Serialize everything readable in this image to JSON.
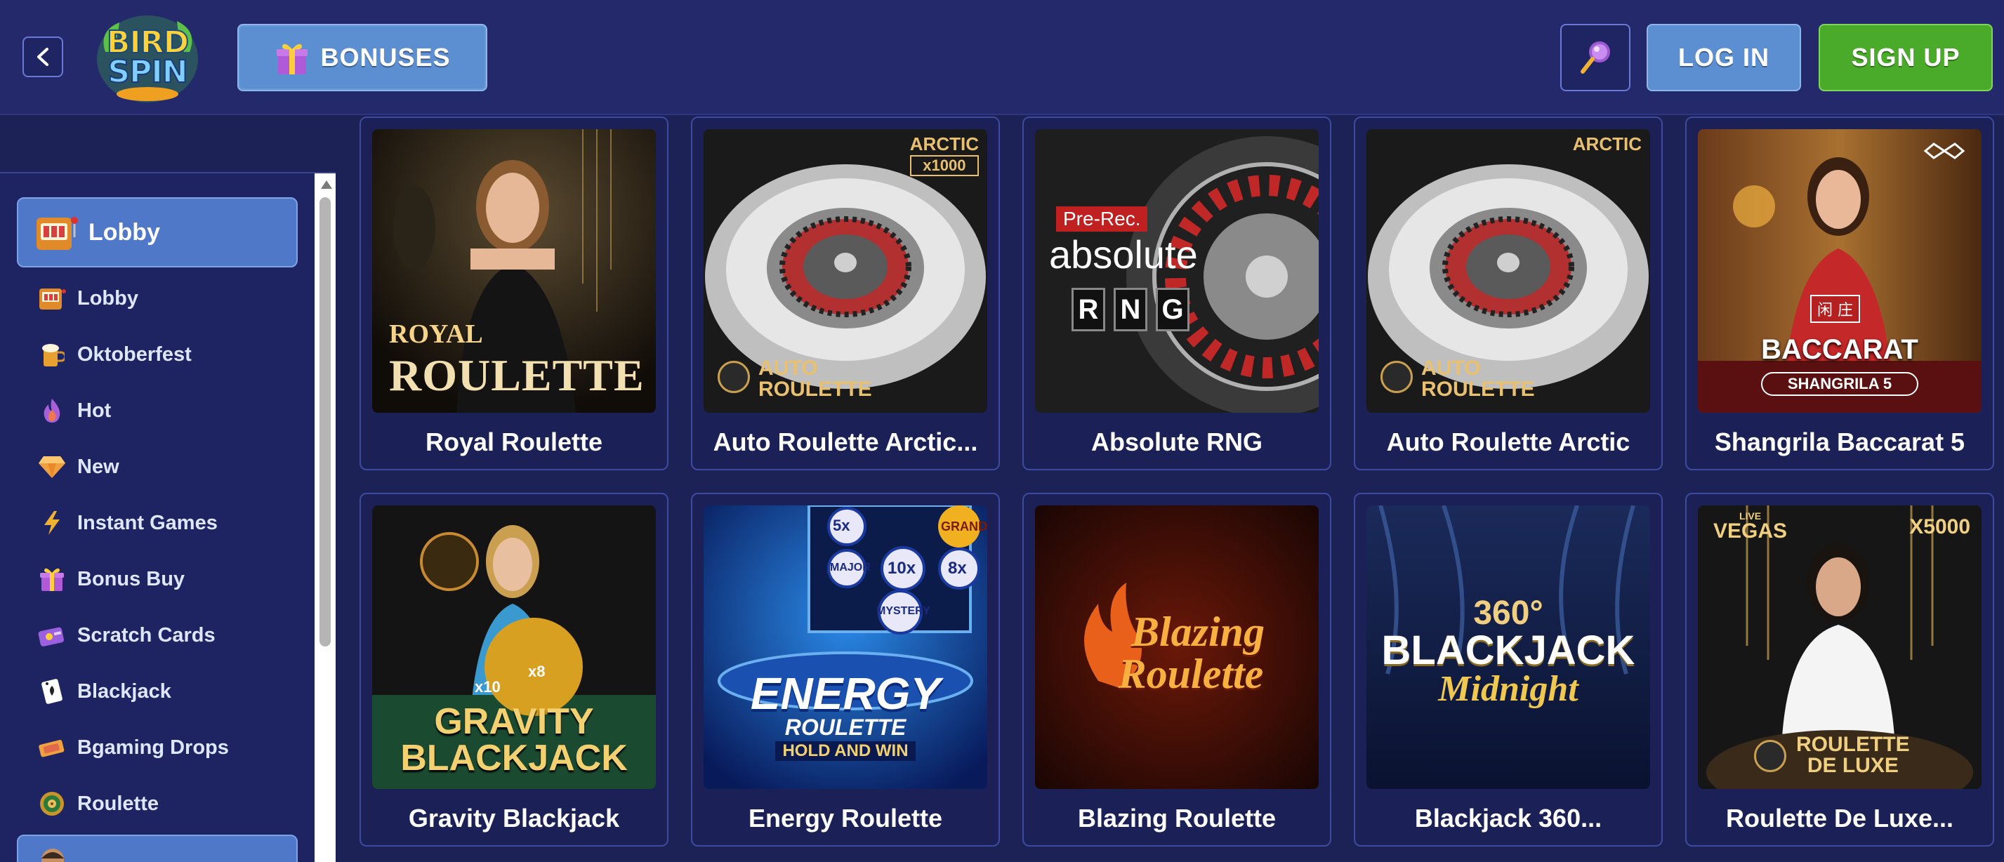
{
  "header": {
    "logo_line1": "BIRD",
    "logo_line2": "SPIN",
    "bonuses_label": "BONUSES",
    "login_label": "LOG IN",
    "signup_label": "SIGN UP",
    "icons": [
      "chevron-left-icon",
      "gift-icon",
      "magnifier-icon"
    ]
  },
  "sidebar": {
    "active_item": {
      "label": "Lobby",
      "icon": "slot-machine-icon"
    },
    "items": [
      {
        "label": "Lobby",
        "icon": "slot-machine-icon"
      },
      {
        "label": "Oktoberfest",
        "icon": "beer-icon"
      },
      {
        "label": "Hot",
        "icon": "flame-icon"
      },
      {
        "label": "New",
        "icon": "diamond-icon"
      },
      {
        "label": "Instant Games",
        "icon": "lightning-icon"
      },
      {
        "label": "Bonus Buy",
        "icon": "gift-icon"
      },
      {
        "label": "Scratch Cards",
        "icon": "scratch-card-icon"
      },
      {
        "label": "Blackjack",
        "icon": "playing-card-icon"
      },
      {
        "label": "Bgaming Drops",
        "icon": "ticket-icon"
      },
      {
        "label": "Roulette",
        "icon": "roulette-icon"
      }
    ]
  },
  "games": [
    {
      "title": "Royal Roulette",
      "art": [
        "ROYAL",
        "ROULETTE"
      ]
    },
    {
      "title": "Auto Roulette Arctic...",
      "art": [
        "ARCTIC",
        "x1000",
        "AUTO",
        "ROULETTE"
      ]
    },
    {
      "title": "Absolute RNG",
      "art": [
        "Pre-Rec.",
        "absolute",
        "R",
        "N",
        "G"
      ]
    },
    {
      "title": "Auto Roulette Arctic",
      "art": [
        "ARCTIC",
        "AUTO",
        "ROULETTE"
      ]
    },
    {
      "title": "Shangrila Baccarat 5",
      "art": [
        "闲 庄",
        "BACCARAT",
        "SHANGRILA 5"
      ]
    },
    {
      "title": "Gravity Blackjack",
      "art": [
        "x10",
        "x8",
        "GRAVITY",
        "BLACKJACK"
      ]
    },
    {
      "title": "Energy Roulette",
      "art": [
        "5x",
        "GRAND",
        "MAJOR",
        "10x",
        "8x",
        "MYSTERY",
        "ENERGY",
        "ROULETTE",
        "HOLD AND WIN"
      ]
    },
    {
      "title": "Blazing Roulette",
      "art": [
        "Blazing",
        "Roulette"
      ]
    },
    {
      "title": "Blackjack 360...",
      "art": [
        "360°",
        "BLACKJACK",
        "Midnight"
      ]
    },
    {
      "title": "Roulette De Luxe...",
      "art": [
        "LIVE",
        "VEGAS",
        "X5000",
        "ROULETTE",
        "DE LUXE"
      ]
    }
  ],
  "colors": {
    "background": "#1c2256",
    "header": "#23296b",
    "accent_blue": "#5b8fd1",
    "signup_green": "#4aaa2a"
  }
}
